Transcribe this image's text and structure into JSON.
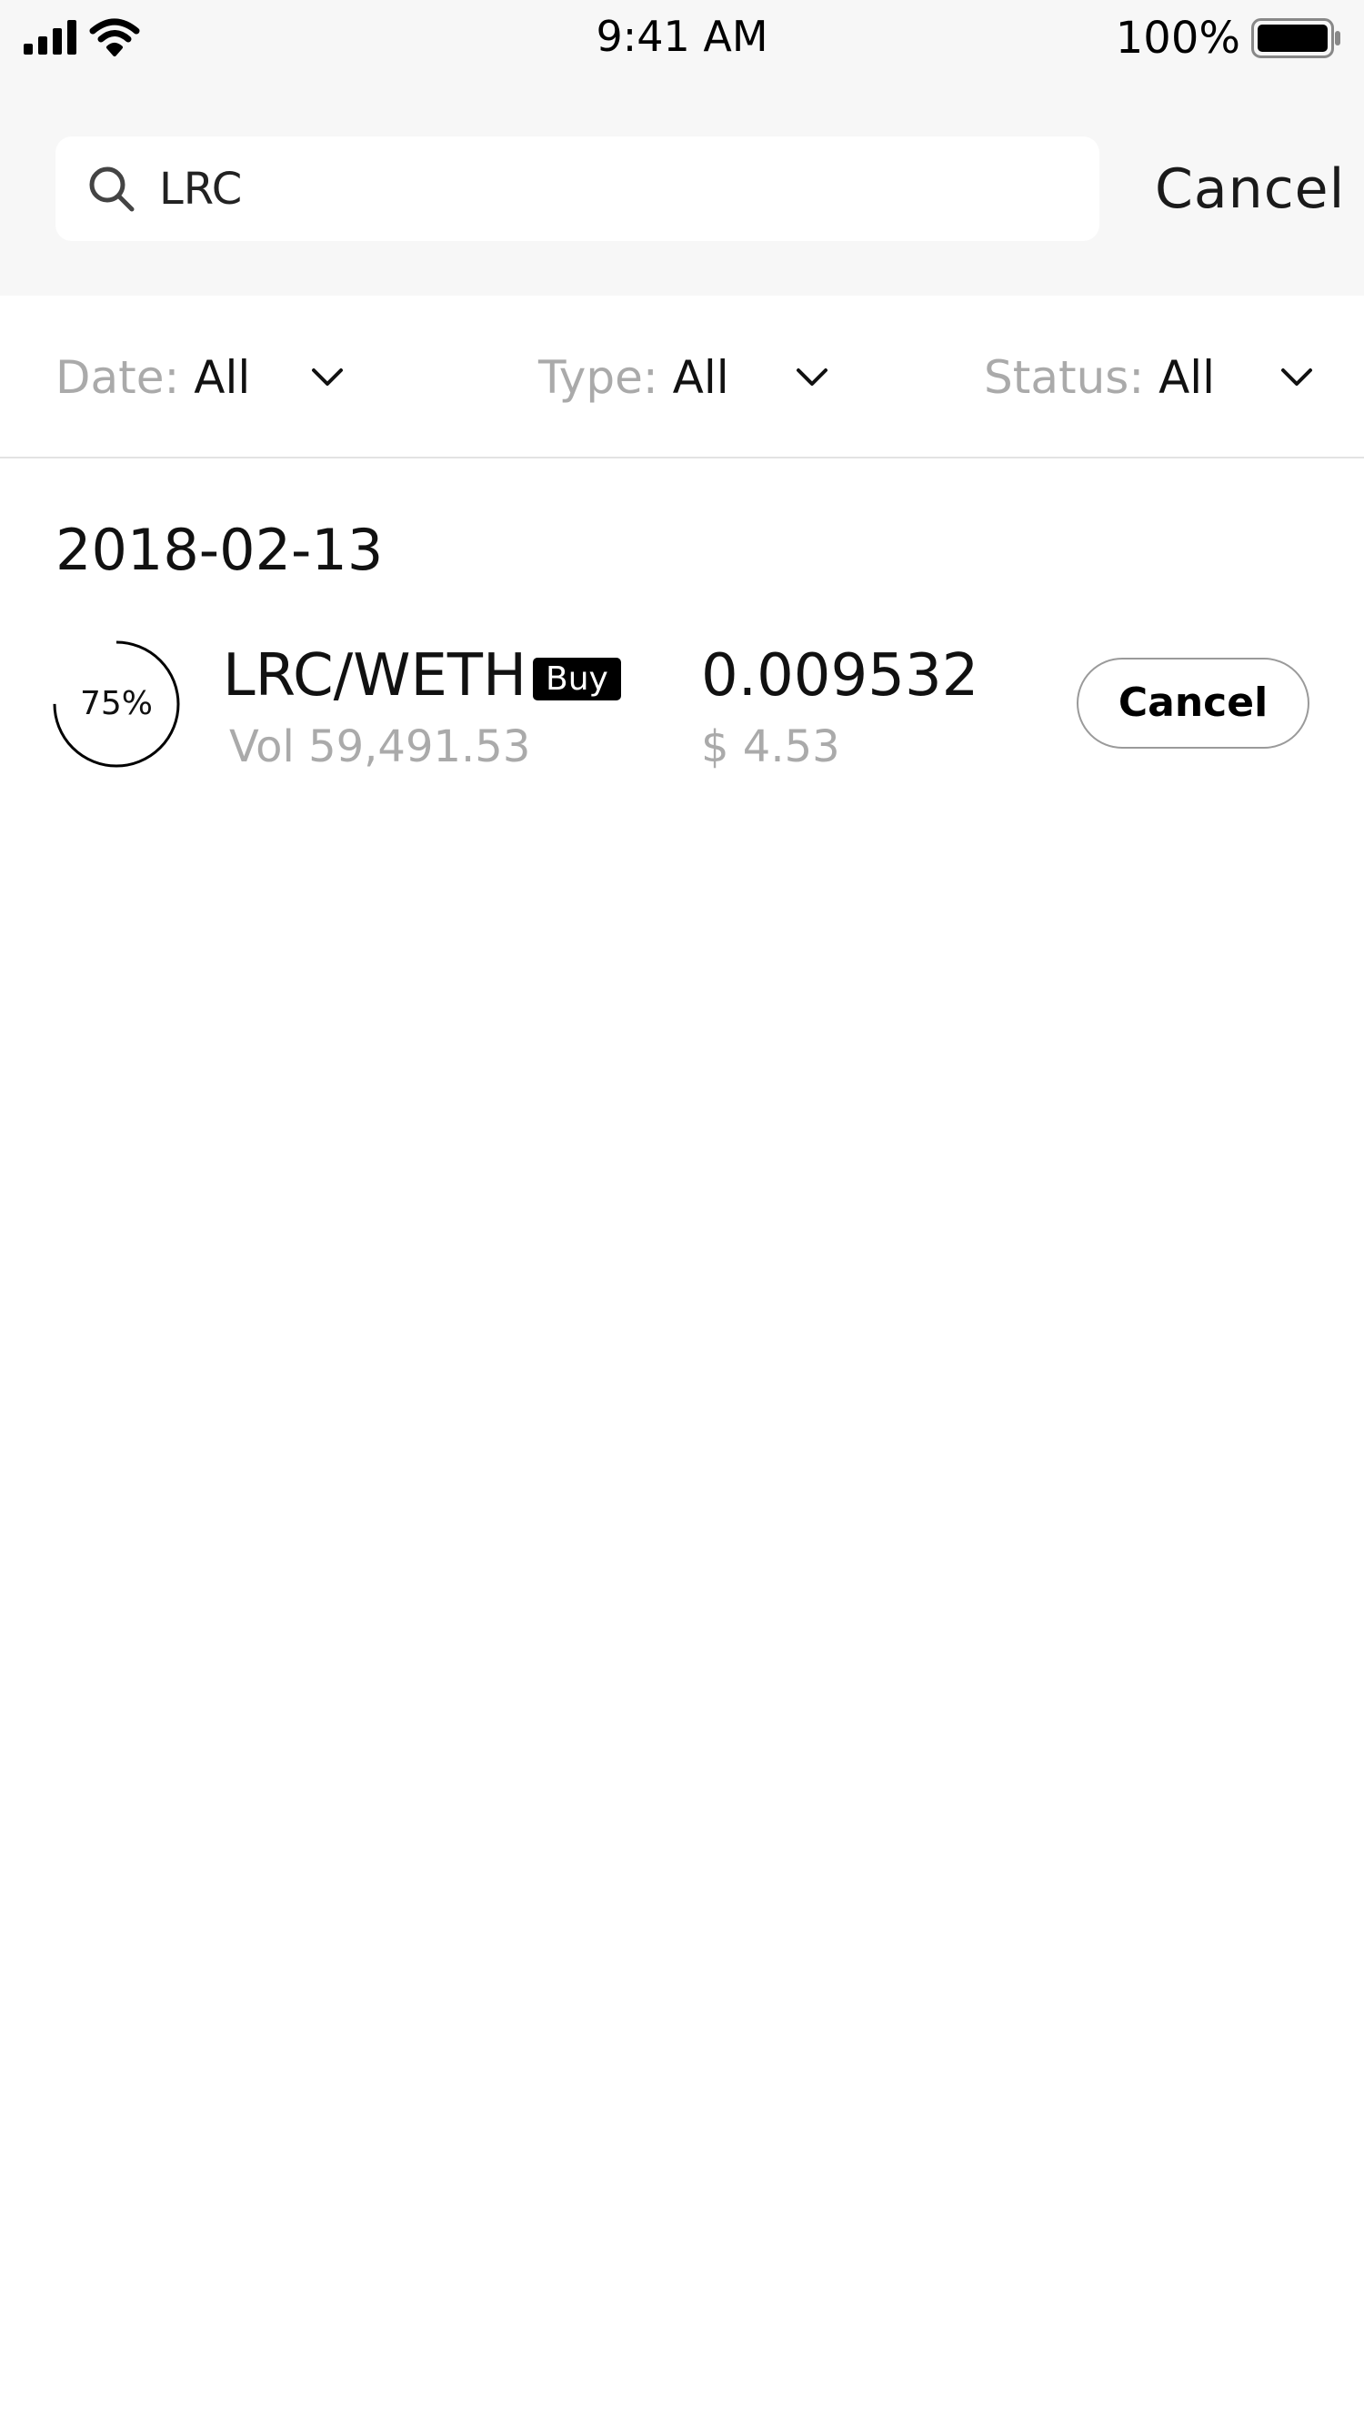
{
  "status_bar": {
    "time": "9:41 AM",
    "battery": "100%",
    "icons": [
      "signal-icon",
      "wifi-icon",
      "battery-icon"
    ]
  },
  "search": {
    "query": "LRC",
    "placeholder": "",
    "cancel_label": "Cancel",
    "icon": "search-icon"
  },
  "filters": [
    {
      "key": "Date:",
      "value": "All",
      "icon": "chevron-down-icon"
    },
    {
      "key": "Type:",
      "value": "All",
      "icon": "chevron-down-icon"
    },
    {
      "key": "Status:",
      "value": "All",
      "icon": "chevron-down-icon"
    }
  ],
  "orders": {
    "date": "2018-02-13",
    "items": [
      {
        "progress_label": "75%",
        "progress_fraction": 0.75,
        "pair": "LRC/WETH",
        "side": "Buy",
        "volume": "Vol 59,491.53",
        "price": "0.009532",
        "value": "$ 4.53",
        "cancel_label": "Cancel"
      }
    ]
  },
  "colors": {
    "header_bg": "#f7f7f7",
    "muted_text": "#aaaaaa",
    "badge_bg": "#000000",
    "divider": "#e3e3e3"
  }
}
